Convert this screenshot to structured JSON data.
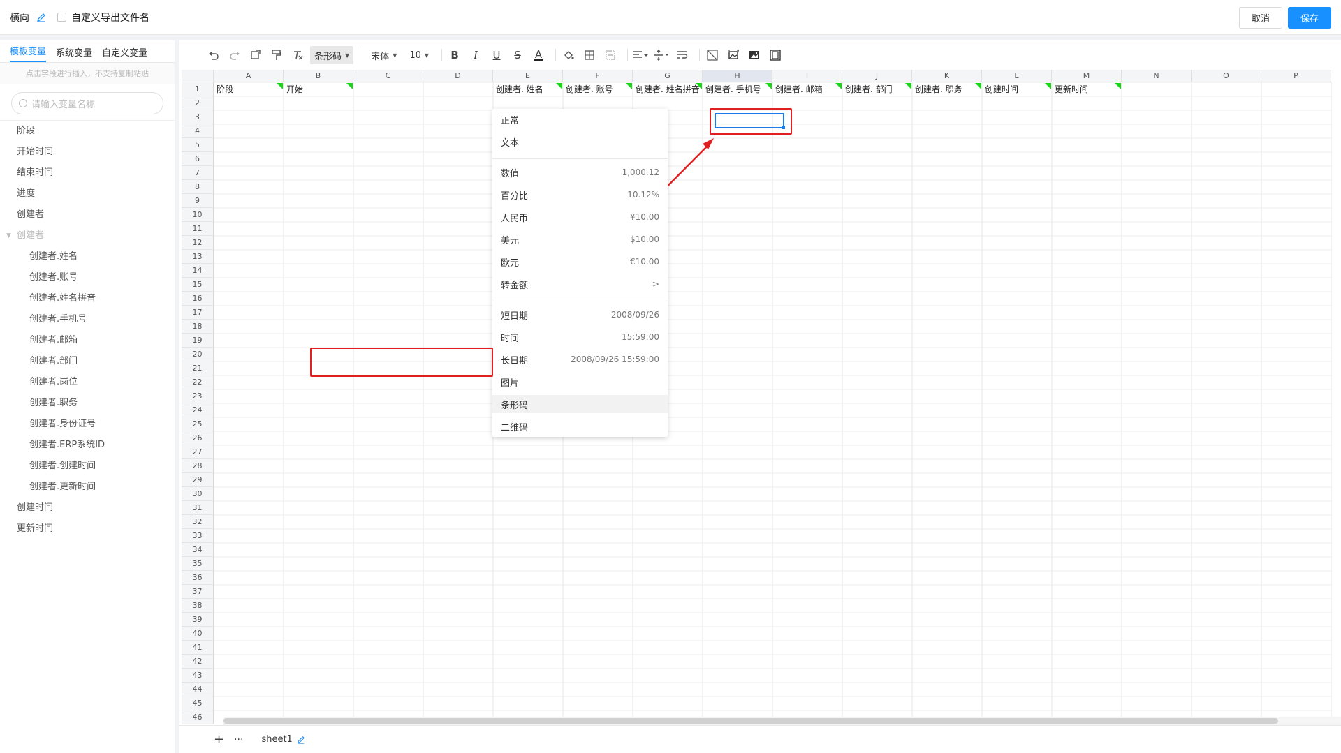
{
  "header": {
    "title": "横向",
    "custom_filename_label": "自定义导出文件名",
    "cancel_label": "取消",
    "save_label": "保存",
    "accent": "#1890ff"
  },
  "sidebar": {
    "tabs": [
      {
        "label": "模板变量",
        "active": true
      },
      {
        "label": "系统变量",
        "active": false
      },
      {
        "label": "自定义变量",
        "active": false
      }
    ],
    "hint": "点击字段进行插入，不支持复制粘贴",
    "search_placeholder": "请输入变量名称",
    "items": [
      {
        "label": "阶段",
        "kind": "item"
      },
      {
        "label": "开始时间",
        "kind": "item"
      },
      {
        "label": "结束时间",
        "kind": "item"
      },
      {
        "label": "进度",
        "kind": "item"
      },
      {
        "label": "创建者",
        "kind": "item"
      },
      {
        "label": "创建者",
        "kind": "group"
      },
      {
        "label": "创建者.姓名",
        "kind": "child"
      },
      {
        "label": "创建者.账号",
        "kind": "child"
      },
      {
        "label": "创建者.姓名拼音",
        "kind": "child"
      },
      {
        "label": "创建者.手机号",
        "kind": "child"
      },
      {
        "label": "创建者.邮箱",
        "kind": "child"
      },
      {
        "label": "创建者.部门",
        "kind": "child"
      },
      {
        "label": "创建者.岗位",
        "kind": "child"
      },
      {
        "label": "创建者.职务",
        "kind": "child"
      },
      {
        "label": "创建者.身份证号",
        "kind": "child"
      },
      {
        "label": "创建者.ERP系统ID",
        "kind": "child"
      },
      {
        "label": "创建者.创建时间",
        "kind": "child"
      },
      {
        "label": "创建者.更新时间",
        "kind": "child"
      },
      {
        "label": "创建时间",
        "kind": "item"
      },
      {
        "label": "更新时间",
        "kind": "item"
      }
    ]
  },
  "toolbar": {
    "format_dropdown": "条形码",
    "font_family": "宋体",
    "font_size": "10"
  },
  "grid": {
    "columns": [
      "A",
      "B",
      "C",
      "D",
      "E",
      "F",
      "G",
      "H",
      "I",
      "J",
      "K",
      "L",
      "M",
      "N",
      "O",
      "P"
    ],
    "selected_column": "H",
    "row_count": 46,
    "row1": [
      "阶段",
      "开始",
      "",
      "",
      "创建者. 姓名",
      "创建者. 账号",
      "创建者. 姓名拼音",
      "创建者. 手机号",
      "创建者. 邮箱",
      "创建者. 部门",
      "创建者. 职务",
      "创建时间",
      "更新时间",
      "",
      "",
      ""
    ],
    "selected_cell": "H3",
    "flag_color": "#18d618"
  },
  "format_menu": {
    "items": [
      {
        "label": "正常",
        "value": ""
      },
      {
        "label": "文本",
        "value": ""
      },
      {
        "label": "数值",
        "value": "1,000.12"
      },
      {
        "label": "百分比",
        "value": "10.12%"
      },
      {
        "label": "人民币",
        "value": "¥10.00"
      },
      {
        "label": "美元",
        "value": "$10.00"
      },
      {
        "label": "欧元",
        "value": "€10.00"
      },
      {
        "label": "转金额",
        "value": ">"
      },
      {
        "label": "短日期",
        "value": "2008/09/26"
      },
      {
        "label": "时间",
        "value": "15:59:00"
      },
      {
        "label": "长日期",
        "value": "2008/09/26 15:59:00"
      },
      {
        "label": "图片",
        "value": ""
      },
      {
        "label": "条形码",
        "value": ""
      },
      {
        "label": "二维码",
        "value": ""
      }
    ],
    "highlighted": "条形码",
    "annotation_color": "#e02020"
  },
  "sheets": [
    {
      "label": "sheet1"
    }
  ]
}
